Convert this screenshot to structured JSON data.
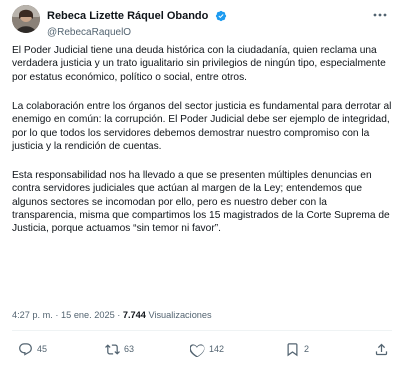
{
  "author": {
    "display_name": "Rebeca Lizette Ráquel Obando",
    "handle": "@RebecaRaquelO"
  },
  "paragraphs": [
    "El Poder Judicial tiene una deuda histórica con la ciudadanía, quien reclama una verdadera justicia y un trato igualitario sin privilegios de ningún tipo, especialmente por estatus económico, político o social, entre otros.",
    "La colaboración entre los órganos del sector justicia es fundamental para derrotar al enemigo en común: la corrupción. El Poder Judicial debe ser ejemplo de integridad, por lo que todos los servidores debemos demostrar nuestro compromiso con la justicia y la rendición de cuentas.",
    "Esta responsabilidad nos ha llevado a que se presenten múltiples denuncias en contra servidores judiciales que actúan al margen de la Ley; entendemos que algunos sectores se incomodan por ello, pero es nuestro deber con la transparencia, misma que compartimos los 15 magistrados de la Corte Suprema de Justicia, porque actuamos “sin temor ni favor”."
  ],
  "meta": {
    "time": "4:27 p. m.",
    "separator": "·",
    "date": "15 ene. 2025",
    "views_count": "7.744",
    "views_label": "Visualizaciones"
  },
  "actions": {
    "replies": "45",
    "retweets": "63",
    "likes": "142",
    "bookmarks": "2"
  },
  "colors": {
    "text": "#0f1419",
    "secondary": "#536471",
    "verified": "#1d9bf0",
    "divider": "#eff3f4"
  }
}
